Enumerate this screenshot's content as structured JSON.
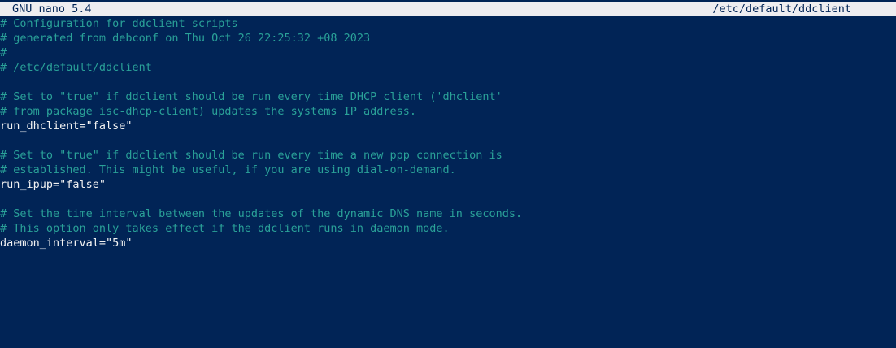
{
  "window": {
    "app_title": "GNU nano 5.4",
    "file_path": "/etc/default/ddclient"
  },
  "editor": {
    "lines": [
      {
        "kind": "comment",
        "text": "# Configuration for ddclient scripts"
      },
      {
        "kind": "comment",
        "text": "# generated from debconf on Thu Oct 26 22:25:32 +08 2023"
      },
      {
        "kind": "comment",
        "text": "#"
      },
      {
        "kind": "comment",
        "text": "# /etc/default/ddclient"
      },
      {
        "kind": "blank",
        "text": ""
      },
      {
        "kind": "comment",
        "text": "# Set to \"true\" if ddclient should be run every time DHCP client ('dhclient'"
      },
      {
        "kind": "comment",
        "text": "# from package isc-dhcp-client) updates the systems IP address."
      },
      {
        "kind": "code",
        "text": "run_dhclient=\"false\""
      },
      {
        "kind": "blank",
        "text": ""
      },
      {
        "kind": "comment",
        "text": "# Set to \"true\" if ddclient should be run every time a new ppp connection is"
      },
      {
        "kind": "comment",
        "text": "# established. This might be useful, if you are using dial-on-demand."
      },
      {
        "kind": "code",
        "text": "run_ipup=\"false\""
      },
      {
        "kind": "blank",
        "text": ""
      },
      {
        "kind": "comment",
        "text": "# Set the time interval between the updates of the dynamic DNS name in seconds."
      },
      {
        "kind": "comment",
        "text": "# This option only takes effect if the ddclient runs in daemon mode."
      },
      {
        "kind": "code",
        "text": "daemon_interval=\"5m\""
      }
    ]
  },
  "colors": {
    "background": "#012456",
    "titlebar_bg": "#eeedf0",
    "titlebar_fg": "#012456",
    "comment": "#2aa198",
    "code": "#f2f2f2"
  }
}
